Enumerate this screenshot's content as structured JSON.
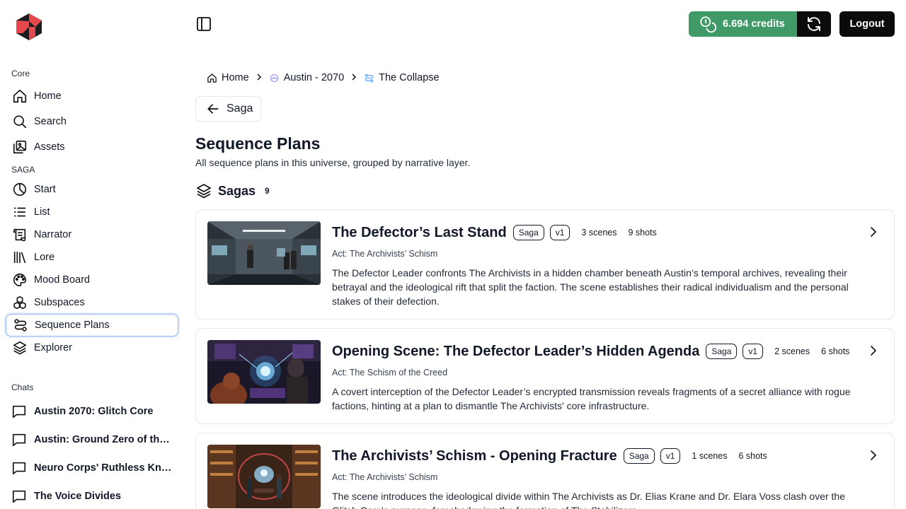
{
  "app": {
    "credits_label": "6.694 credits",
    "logout_label": "Logout",
    "colors": {
      "credits_green": "#3f9a68",
      "dark_button": "#0b0b0b",
      "active_outline": "#93b8f0"
    }
  },
  "sidebar": {
    "core_label": "Core",
    "core_items": [
      {
        "label": "Home",
        "icon": "home-icon"
      },
      {
        "label": "Search",
        "icon": "search-icon"
      },
      {
        "label": "Assets",
        "icon": "assets-icon"
      }
    ],
    "saga_label": "SAGA",
    "saga_items": [
      {
        "label": "Start",
        "icon": "start-icon"
      },
      {
        "label": "List",
        "icon": "list-icon"
      },
      {
        "label": "Narrator",
        "icon": "scroll-icon"
      },
      {
        "label": "Lore",
        "icon": "library-icon"
      },
      {
        "label": "Mood Board",
        "icon": "palette-icon"
      },
      {
        "label": "Subspaces",
        "icon": "boxes-icon"
      },
      {
        "label": "Sequence Plans",
        "icon": "route-icon",
        "active": true
      },
      {
        "label": "Explorer",
        "icon": "layers-icon"
      }
    ],
    "chats_label": "Chats",
    "chats": [
      {
        "label": "Austin 2070: Glitch Core"
      },
      {
        "label": "Austin: Ground Zero of the ..."
      },
      {
        "label": "Neuro Corps' Ruthless Kno..."
      },
      {
        "label": "The Voice Divides"
      }
    ]
  },
  "breadcrumb": [
    {
      "label": "Home",
      "icon": "home-icon"
    },
    {
      "label": "Austin - 2070",
      "icon": "universe-icon"
    },
    {
      "label": "The Collapse",
      "icon": "route-icon"
    }
  ],
  "back_button_label": "Saga",
  "page": {
    "title": "Sequence Plans",
    "subtitle": "All sequence plans in this universe, grouped by narrative layer."
  },
  "group": {
    "title": "Sagas",
    "count": "9"
  },
  "cards": [
    {
      "title": "The Defector’s Last Stand",
      "tag": "Saga",
      "version": "v1",
      "scenes": "3 scenes",
      "shots": "9 shots",
      "act": "Act: The Archivists’ Schism",
      "description": "The Defector Leader confronts The Archivists in a hidden chamber beneath Austin’s temporal archives, revealing their betrayal and the ideological rift that split the faction. The scene establishes their radical individualism and the personal stakes of their defection."
    },
    {
      "title": "Opening Scene: The Defector Leader’s Hidden Agenda",
      "tag": "Saga",
      "version": "v1",
      "scenes": "2 scenes",
      "shots": "6 shots",
      "act": "Act: The Schism of the Creed",
      "description": "A covert interception of the Defector Leader’s encrypted transmission reveals fragments of a secret alliance with rogue factions, hinting at a plan to dismantle The Archivists' core infrastructure."
    },
    {
      "title": "The Archivists’ Schism - Opening Fracture",
      "tag": "Saga",
      "version": "v1",
      "scenes": "1 scenes",
      "shots": "6 shots",
      "act": "Act: The Archivists’ Schism",
      "description": "The scene introduces the ideological divide within The Archivists as Dr. Elias Krane and Dr. Elara Voss clash over the Glitch Core's purpose, foreshadowing the formation of The Stabilizers."
    }
  ]
}
